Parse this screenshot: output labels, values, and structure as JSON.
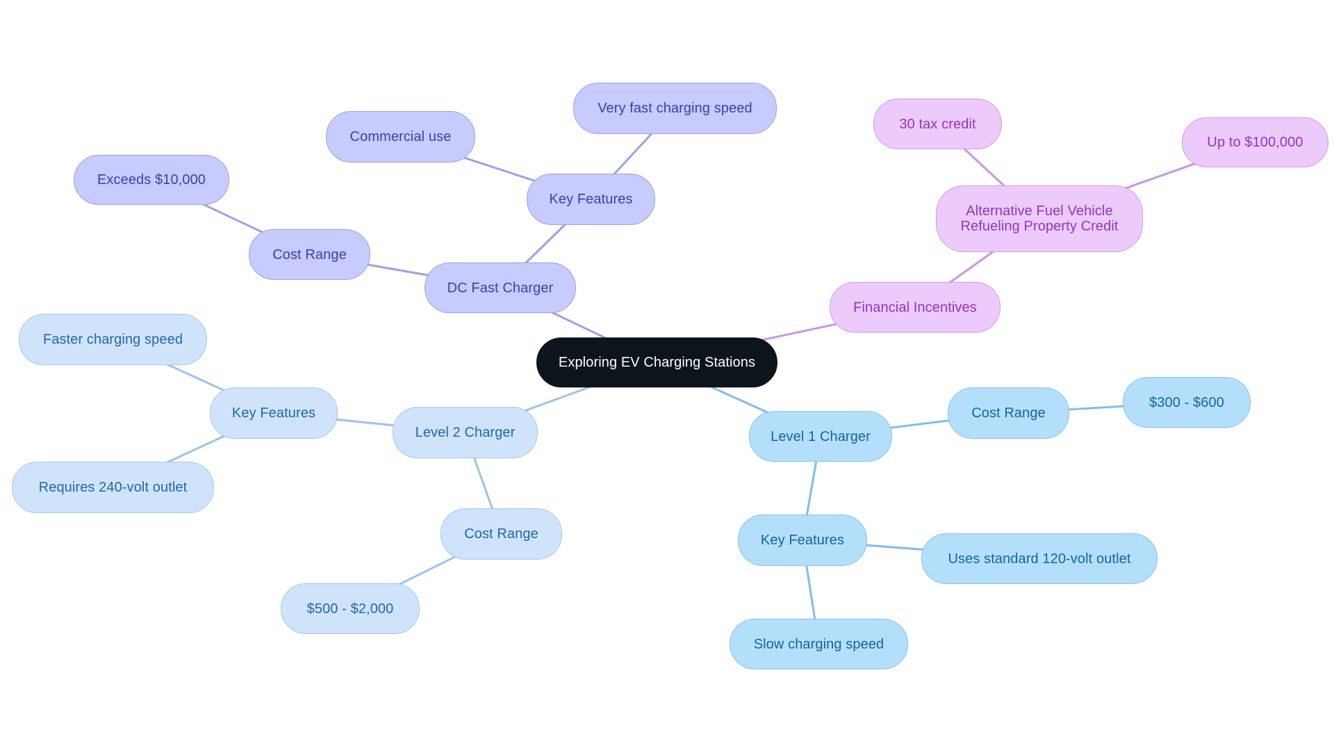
{
  "title": "Exploring EV Charging Stations",
  "colors": {
    "root_fill": "#0d141c",
    "dc_fast_edge": "#9ca0e8",
    "financial_edge": "#c894e6",
    "level2_edge": "#9cc2ea",
    "level1_edge": "#7fbde8"
  },
  "nodes": {
    "root": {
      "label": "Exploring EV Charging Stations"
    },
    "dc_fast": {
      "label": "DC Fast Charger",
      "cost_range": {
        "label": "Cost Range",
        "value": "Exceeds $10,000"
      },
      "key_features": {
        "label": "Key Features",
        "items": [
          "Commercial use",
          "Very fast charging speed"
        ]
      }
    },
    "financial": {
      "label": "Financial Incentives",
      "credit": {
        "label": "Alternative Fuel Vehicle\nRefueling Property Credit",
        "items": [
          "30 tax credit",
          "Up to $100,000"
        ]
      }
    },
    "level2": {
      "label": "Level 2 Charger",
      "key_features": {
        "label": "Key Features",
        "items": [
          "Faster charging speed",
          "Requires 240-volt outlet"
        ]
      },
      "cost_range": {
        "label": "Cost Range",
        "value": "$500 - $2,000"
      }
    },
    "level1": {
      "label": "Level 1 Charger",
      "cost_range": {
        "label": "Cost Range",
        "value": "$300 - $600"
      },
      "key_features": {
        "label": "Key Features",
        "items": [
          "Uses standard 120-volt outlet",
          "Slow charging speed"
        ]
      }
    }
  }
}
